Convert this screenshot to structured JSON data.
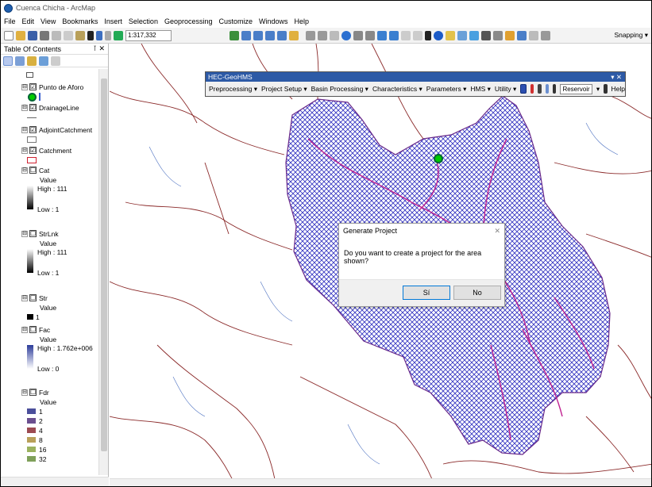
{
  "window": {
    "title": "Cuenca Chicha - ArcMap"
  },
  "menu": [
    "File",
    "Edit",
    "View",
    "Bookmarks",
    "Insert",
    "Selection",
    "Geoprocessing",
    "Customize",
    "Windows",
    "Help"
  ],
  "toolbar": {
    "scale": "1:317,332",
    "snapping": "Snapping ▾"
  },
  "toc": {
    "title": "Table Of Contents",
    "layers": [
      {
        "name": "Punto de Aforo",
        "checked": "☑",
        "expander": "⊟"
      },
      {
        "name": "DrainageLine",
        "checked": "☑",
        "expander": "⊟"
      },
      {
        "name": "AdjointCatchment",
        "checked": "☑",
        "expander": "⊟"
      },
      {
        "name": "Catchment",
        "checked": "☑",
        "expander": "⊟"
      },
      {
        "name": "Cat",
        "checked": "☐",
        "expander": "⊟"
      },
      {
        "name": "StrLnk",
        "checked": "☐",
        "expander": "⊟"
      },
      {
        "name": "Str",
        "checked": "☐",
        "expander": "⊟"
      },
      {
        "name": "Fac",
        "checked": "☐",
        "expander": "⊟"
      },
      {
        "name": "Fdr",
        "checked": "☐",
        "expander": "⊟"
      }
    ],
    "legend": {
      "value": "Value",
      "cat_high": "High : 111",
      "cat_low": "Low : 1",
      "strlnk_high": "High : 111",
      "strlnk_low": "Low : 1",
      "str_value": "1",
      "fac_high": "High : 1.762e+006",
      "fac_low": "Low : 0",
      "fdr_values": [
        "1",
        "2",
        "4",
        "8",
        "16",
        "32"
      ],
      "fdr_colors": [
        "#4b4f9b",
        "#6b4f8f",
        "#9c4a52",
        "#b9a05a",
        "#9bb25f",
        "#7fa05a"
      ]
    }
  },
  "hec": {
    "title": "HEC-GeoHMS",
    "menus": [
      "Preprocessing ▾",
      "Project Setup ▾",
      "Basin Processing ▾",
      "Characteristics ▾",
      "Parameters ▾",
      "HMS ▾",
      "Utility ▾"
    ],
    "reservoir": "Reservoir",
    "help": "Help"
  },
  "dialog": {
    "title": "Generate Project",
    "message": "Do you want to create a project for the area shown?",
    "yes": "Sí",
    "no": "No"
  },
  "colors": {
    "catchment": "#3030c0",
    "rivers": "#8b2a2a",
    "drainage": "#c02090",
    "streams": "#4a6fc0"
  }
}
